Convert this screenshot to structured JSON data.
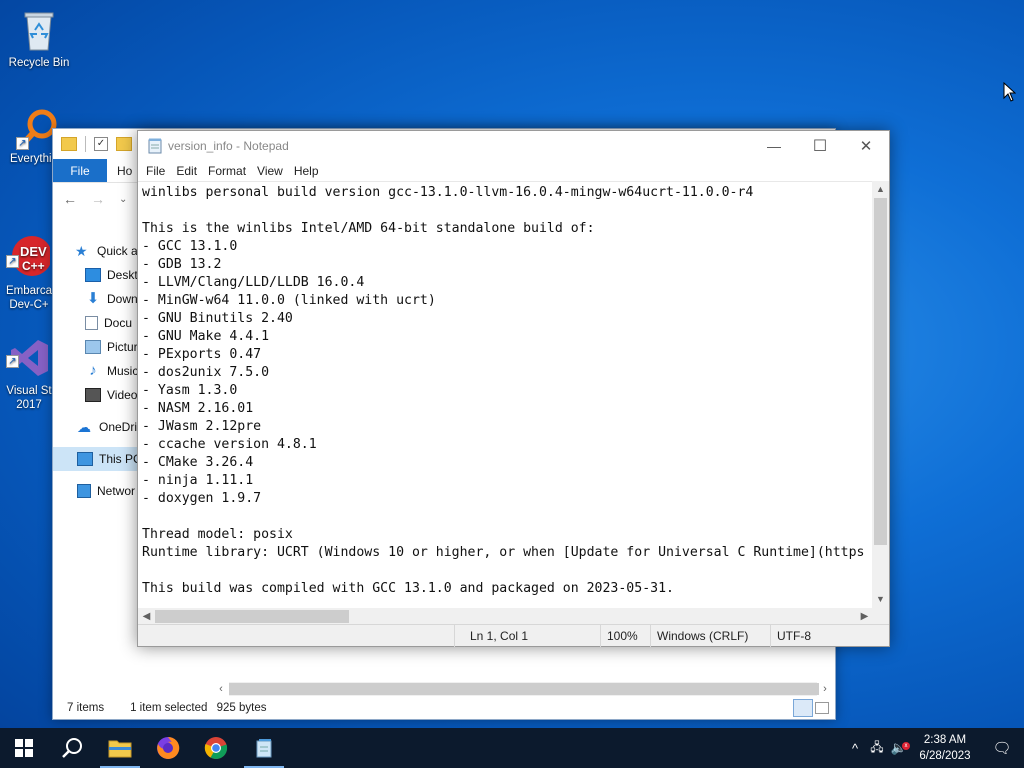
{
  "desktop": {
    "icons": [
      {
        "label": "Recycle Bin"
      },
      {
        "label": "Everythi"
      },
      {
        "label": "Embarca\nDev-C+"
      },
      {
        "label": "Visual St\n2017"
      }
    ]
  },
  "explorer": {
    "ribbon": {
      "file": "File",
      "home": "Ho"
    },
    "nav": [
      {
        "label": "Quick a"
      },
      {
        "label": "Deskto"
      },
      {
        "label": "Downl"
      },
      {
        "label": "Docu"
      },
      {
        "label": "Pictur"
      },
      {
        "label": "Music"
      },
      {
        "label": "Videos"
      },
      {
        "label": "OneDriv"
      },
      {
        "label": "This PC"
      },
      {
        "label": "Networ"
      }
    ],
    "status": {
      "items": "7 items",
      "selected": "1 item selected",
      "size": "925 bytes"
    }
  },
  "notepad": {
    "title": "version_info - Notepad",
    "menu": [
      "File",
      "Edit",
      "Format",
      "View",
      "Help"
    ],
    "content": "winlibs personal build version gcc-13.1.0-llvm-16.0.4-mingw-w64ucrt-11.0.0-r4\n\nThis is the winlibs Intel/AMD 64-bit standalone build of:\n- GCC 13.1.0\n- GDB 13.2\n- LLVM/Clang/LLD/LLDB 16.0.4\n- MinGW-w64 11.0.0 (linked with ucrt)\n- GNU Binutils 2.40\n- GNU Make 4.4.1\n- PExports 0.47\n- dos2unix 7.5.0\n- Yasm 1.3.0\n- NASM 2.16.01\n- JWasm 2.12pre\n- ccache version 4.8.1\n- CMake 3.26.4\n- ninja 1.11.1\n- doxygen 1.9.7\n\nThread model: posix\nRuntime library: UCRT (Windows 10 or higher, or when [Update for Universal C Runtime](https\n\nThis build was compiled with GCC 13.1.0 and packaged on 2023-05-31.",
    "status": {
      "position": "Ln 1, Col 1",
      "zoom": "100%",
      "line_endings": "Windows (CRLF)",
      "encoding": "UTF-8"
    }
  },
  "taskbar": {
    "time": "2:38 AM",
    "date": "6/28/2023"
  },
  "colors": {
    "accent": "#1a6fc9",
    "taskbar": "#0c1a2d"
  }
}
